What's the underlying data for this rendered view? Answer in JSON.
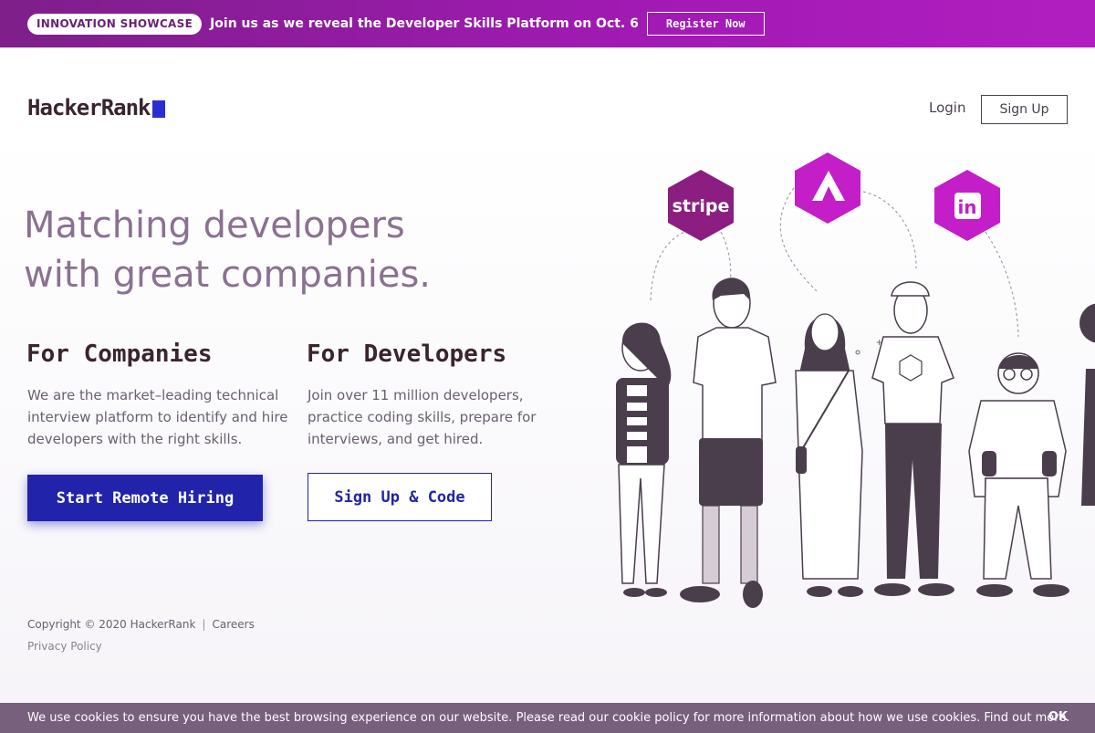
{
  "promo": {
    "badge": "INNOVATION SHOWCASE",
    "text": "Join us as we reveal the Developer Skills Platform on Oct. 6",
    "button": "Register Now"
  },
  "header": {
    "logo": "HackerRank",
    "login": "Login",
    "signup": "Sign Up"
  },
  "hero": {
    "headline_line1": "Matching developers",
    "headline_line2": "with great companies."
  },
  "companies": {
    "title": "For Companies",
    "text": "We are the market–leading technical interview platform to identify and hire developers with the right skills.",
    "button": "Start Remote Hiring"
  },
  "developers": {
    "title": "For Developers",
    "text": "Join over 11 million developers, practice coding skills, prepare for interviews, and get hired.",
    "button": "Sign Up & Code"
  },
  "illustration": {
    "logos": [
      "stripe",
      "atlassian-icon",
      "linkedin-icon"
    ],
    "stripe_label": "stripe",
    "linkedin_label": "in"
  },
  "footer": {
    "copyright": "Copyright © 2020 HackerRank",
    "separator": "|",
    "careers": "Careers",
    "privacy": "Privacy Policy"
  },
  "cookie": {
    "text": "We use cookies to ensure you have the best browsing experience on our website. Please read our cookie policy for more information about how we use cookies. Find out more.",
    "ok": "OK"
  },
  "colors": {
    "promo_bg": "#a21ab5",
    "brand_blue": "#2124ab",
    "headline": "#8a7191",
    "cookie_bg": "#76607c",
    "hex_stripe": "#8b1e80",
    "hex_magenta": "#c41ec8"
  }
}
